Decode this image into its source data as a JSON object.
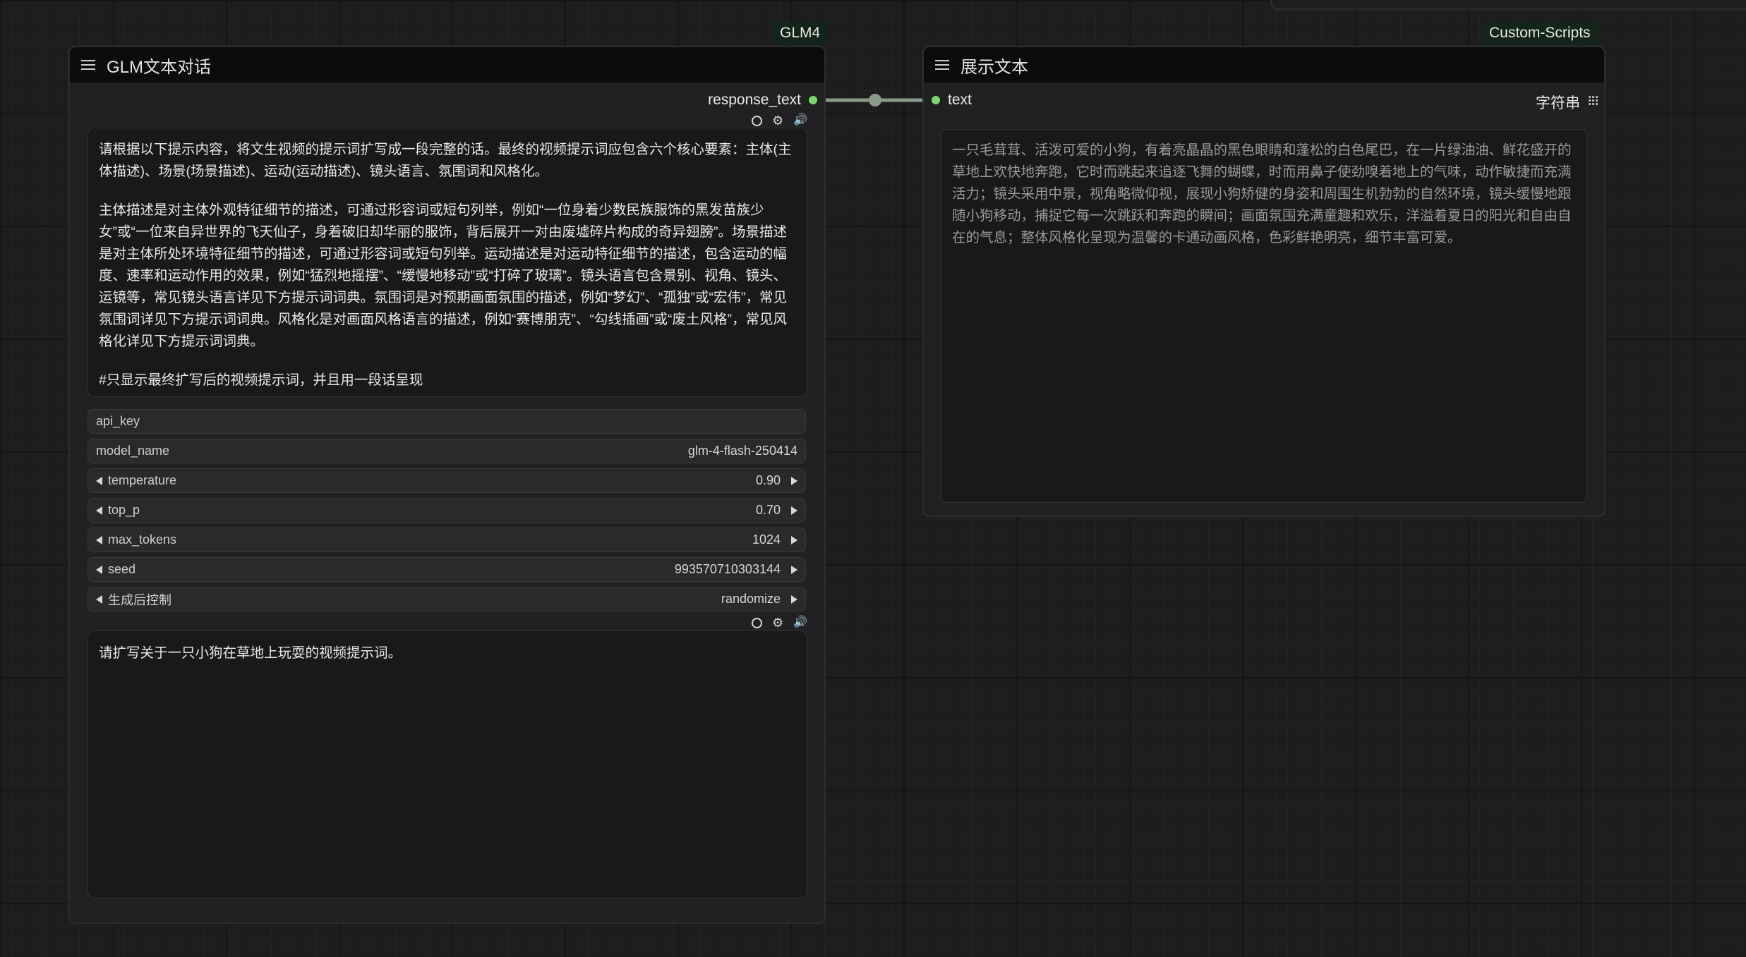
{
  "glm_node": {
    "badge": "GLM4",
    "title": "GLM文本对话",
    "output_label": "response_text",
    "system_prompt_paragraphs": [
      "请根据以下提示内容，将文生视频的提示词扩写成一段完整的话。最终的视频提示词应包含六个核心要素：主体(主体描述)、场景(场景描述)、运动(运动描述)、镜头语言、氛围词和风格化。",
      "主体描述是对主体外观特征细节的描述，可通过形容词或短句列举，例如“一位身着少数民族服饰的黑发苗族少女”或“一位来自异世界的飞天仙子，身着破旧却华丽的服饰，背后展开一对由废墟碎片构成的奇异翅膀”。场景描述是对主体所处环境特征细节的描述，可通过形容词或短句列举。运动描述是对运动特征细节的描述，包含运动的幅度、速率和运动作用的效果，例如“猛烈地摇摆”、“缓慢地移动”或“打碎了玻璃”。镜头语言包含景别、视角、镜头、运镜等，常见镜头语言详见下方提示词词典。氛围词是对预期画面氛围的描述，例如“梦幻”、“孤独”或“宏伟”，常见氛围词详见下方提示词词典。风格化是对画面风格语言的描述，例如“赛博朋克”、“勾线插画”或“废土风格”，常见风格化详见下方提示词词典。",
      "#只显示最终扩写后的视频提示词，并且用一段话呈现"
    ],
    "api_key_label": "api_key",
    "model_name": {
      "label": "model_name",
      "value": "glm-4-flash-250414"
    },
    "temperature": {
      "label": "temperature",
      "value": "0.90"
    },
    "top_p": {
      "label": "top_p",
      "value": "0.70"
    },
    "max_tokens": {
      "label": "max_tokens",
      "value": "1024"
    },
    "seed": {
      "label": "seed",
      "value": "993570710303144"
    },
    "control_after_generate": {
      "label": "生成后控制",
      "value": "randomize"
    },
    "user_prompt": "请扩写关于一只小狗在草地上玩耍的视频提示词。"
  },
  "display_node": {
    "badge": "Custom-Scripts",
    "title": "展示文本",
    "input_label": "text",
    "widget_type": "字符串",
    "content": "一只毛茸茸、活泼可爱的小狗，有着亮晶晶的黑色眼睛和蓬松的白色尾巴，在一片绿油油、鲜花盛开的草地上欢快地奔跑，它时而跳起来追逐飞舞的蝴蝶，时而用鼻子使劲嗅着地上的气味，动作敏捷而充满活力；镜头采用中景，视角略微仰视，展现小狗矫健的身姿和周围生机勃勃的自然环境，镜头缓慢地跟随小狗移动，捕捉它每一次跳跃和奔跑的瞬间；画面氛围充满童趣和欢乐，洋溢着夏日的阳光和自由自在的气息；整体风格化呈现为温馨的卡通动画风格，色彩鲜艳明亮，细节丰富可爱。"
  },
  "colors": {
    "canvas": "#1d1d1d",
    "node_body": "#212123",
    "node_header": "#0b0b0c",
    "slot_green": "#7bd86a",
    "link": "#8a9a8a"
  }
}
